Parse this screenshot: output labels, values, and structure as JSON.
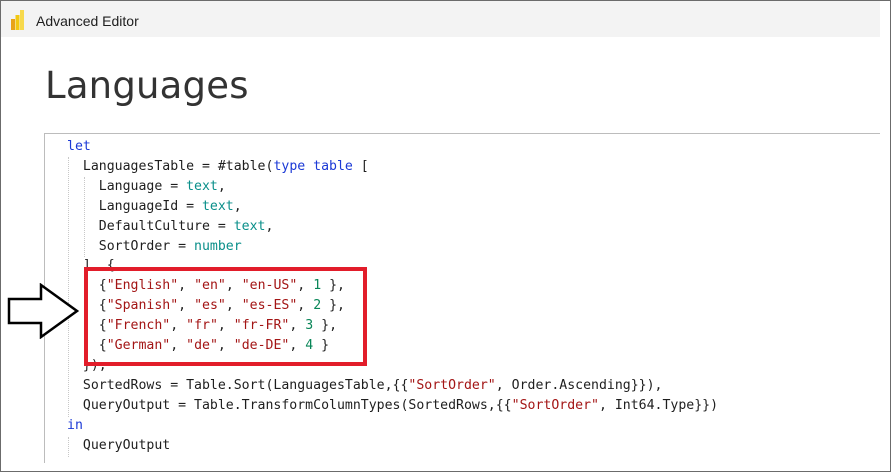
{
  "window": {
    "title": "Advanced Editor",
    "app_icon": "power-bi-icon"
  },
  "query": {
    "name": "Languages"
  },
  "code_lines": [
    [
      {
        "t": "let",
        "c": "kw"
      }
    ],
    [
      {
        "t": "  LanguagesTable = #table(",
        "c": ""
      },
      {
        "t": "type",
        "c": "kw"
      },
      {
        "t": " ",
        "c": ""
      },
      {
        "t": "table",
        "c": "kw"
      },
      {
        "t": " [",
        "c": ""
      }
    ],
    [
      {
        "t": "    Language = ",
        "c": ""
      },
      {
        "t": "text",
        "c": "ty"
      },
      {
        "t": ",",
        "c": ""
      }
    ],
    [
      {
        "t": "    LanguageId = ",
        "c": ""
      },
      {
        "t": "text",
        "c": "ty"
      },
      {
        "t": ",",
        "c": ""
      }
    ],
    [
      {
        "t": "    DefaultCulture = ",
        "c": ""
      },
      {
        "t": "text",
        "c": "ty"
      },
      {
        "t": ",",
        "c": ""
      }
    ],
    [
      {
        "t": "    SortOrder = ",
        "c": ""
      },
      {
        "t": "number",
        "c": "ty"
      }
    ],
    [
      {
        "t": "  ], {",
        "c": ""
      }
    ],
    [
      {
        "t": "    {",
        "c": ""
      },
      {
        "t": "\"English\"",
        "c": "st"
      },
      {
        "t": ", ",
        "c": ""
      },
      {
        "t": "\"en\"",
        "c": "st"
      },
      {
        "t": ", ",
        "c": ""
      },
      {
        "t": "\"en-US\"",
        "c": "st"
      },
      {
        "t": ", ",
        "c": ""
      },
      {
        "t": "1",
        "c": "nu"
      },
      {
        "t": " },",
        "c": ""
      }
    ],
    [
      {
        "t": "    {",
        "c": ""
      },
      {
        "t": "\"Spanish\"",
        "c": "st"
      },
      {
        "t": ", ",
        "c": ""
      },
      {
        "t": "\"es\"",
        "c": "st"
      },
      {
        "t": ", ",
        "c": ""
      },
      {
        "t": "\"es-ES\"",
        "c": "st"
      },
      {
        "t": ", ",
        "c": ""
      },
      {
        "t": "2",
        "c": "nu"
      },
      {
        "t": " },",
        "c": ""
      }
    ],
    [
      {
        "t": "    {",
        "c": ""
      },
      {
        "t": "\"French\"",
        "c": "st"
      },
      {
        "t": ", ",
        "c": ""
      },
      {
        "t": "\"fr\"",
        "c": "st"
      },
      {
        "t": ", ",
        "c": ""
      },
      {
        "t": "\"fr-FR\"",
        "c": "st"
      },
      {
        "t": ", ",
        "c": ""
      },
      {
        "t": "3",
        "c": "nu"
      },
      {
        "t": " },",
        "c": ""
      }
    ],
    [
      {
        "t": "    {",
        "c": ""
      },
      {
        "t": "\"German\"",
        "c": "st"
      },
      {
        "t": ", ",
        "c": ""
      },
      {
        "t": "\"de\"",
        "c": "st"
      },
      {
        "t": ", ",
        "c": ""
      },
      {
        "t": "\"de-DE\"",
        "c": "st"
      },
      {
        "t": ", ",
        "c": ""
      },
      {
        "t": "4",
        "c": "nu"
      },
      {
        "t": " }",
        "c": ""
      }
    ],
    [
      {
        "t": "  }),",
        "c": ""
      }
    ],
    [
      {
        "t": "  SortedRows = Table.Sort(LanguagesTable,{{",
        "c": ""
      },
      {
        "t": "\"SortOrder\"",
        "c": "st"
      },
      {
        "t": ", Order.Ascending}}),",
        "c": ""
      }
    ],
    [
      {
        "t": "  QueryOutput = Table.TransformColumnTypes(SortedRows,{{",
        "c": ""
      },
      {
        "t": "\"SortOrder\"",
        "c": "st"
      },
      {
        "t": ", Int64.Type}})",
        "c": ""
      }
    ],
    [
      {
        "t": "in",
        "c": "kw"
      }
    ],
    [
      {
        "t": "  QueryOutput",
        "c": ""
      }
    ]
  ],
  "annotations": {
    "highlight_color": "#e21d2a",
    "arrow_icon": "right-arrow-outline-icon"
  },
  "colors": {
    "keyword": "#1b39d6",
    "type": "#0a8f8a",
    "string": "#a31515",
    "number": "#098658"
  }
}
